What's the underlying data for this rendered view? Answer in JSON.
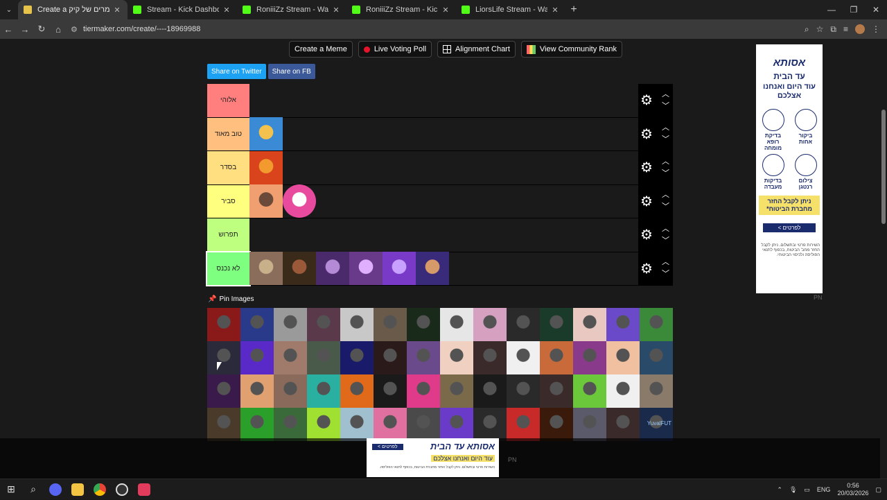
{
  "browser": {
    "tabs": [
      {
        "label": "Create a גירוג סטרימרים של קיק",
        "favicon": "tiermaker",
        "active": true
      },
      {
        "label": "Stream - Kick Dashboard",
        "favicon": "kick",
        "active": false
      },
      {
        "label": "RoniiiZz Stream - Watch Live on",
        "favicon": "kick",
        "active": false
      },
      {
        "label": "RoniiiZz Stream - Kick Dashboa",
        "favicon": "kick",
        "active": false
      },
      {
        "label": "LiorsLife Stream - Watch Live on",
        "favicon": "kick",
        "active": false
      }
    ],
    "url": "tiermaker.com/create/----18969988"
  },
  "toolbar": {
    "create_meme": "Create a Meme",
    "live_voting_poll": "Live Voting Poll",
    "alignment_chart": "Alignment Chart",
    "view_community_rank": "View Community Rank"
  },
  "share": {
    "twitter": "Share on Twitter",
    "facebook": "Share on FB"
  },
  "tiers": [
    {
      "label": "אלוהי",
      "color": "#ff7f7f",
      "items": 0
    },
    {
      "label": "טוב מאוד",
      "color": "#ffbf7f",
      "items": 1
    },
    {
      "label": "בסדר",
      "color": "#ffdf7f",
      "items": 1
    },
    {
      "label": "סביר",
      "color": "#ffff7f",
      "items": 2
    },
    {
      "label": "תפרוש",
      "color": "#bfff7f",
      "items": 0
    },
    {
      "label": "לא נכנס",
      "color": "#7fff7f",
      "items": 6
    }
  ],
  "pin_images": "Pin Images",
  "pool_last_label": "YuvalFUT",
  "ads": {
    "right": {
      "brand": "אסותא",
      "headline": "עד הבית",
      "subline": "עוד היום ואנחנו אצלכם",
      "services": [
        "ביקור אחות",
        "בדיקת רופא מומחה",
        "צילום רנטגן",
        "בדיקות מעבדה"
      ],
      "promo": "ניתן לקבל החזר מחברת הביטוח*",
      "cta": "לפרטים >",
      "fine": "השירות פרטי ובתשלום. ניתן לקבל החזר מחב' הביטוח, בכפוף לתנאי הפוליסה ולכיסוי הביטוחי.",
      "badge": "PN"
    },
    "bottom": {
      "brand": "אסותא עד הבית",
      "sub": "עוד היום ואנחנו אצלכם",
      "cta": "לפרטים >",
      "fine": "השירות פרטי ובתשלום. ניתן לקבל החזר מחברת הביטוח, בכפוף לתנאי הפוליסה.",
      "badge": "PN"
    }
  },
  "taskbar": {
    "lang": "ENG",
    "time": "0:56",
    "date": "20/03/2026"
  },
  "colors": {
    "twitter": "#1da1f2",
    "facebook": "#3b5998",
    "accent_live": "#e5142b"
  }
}
